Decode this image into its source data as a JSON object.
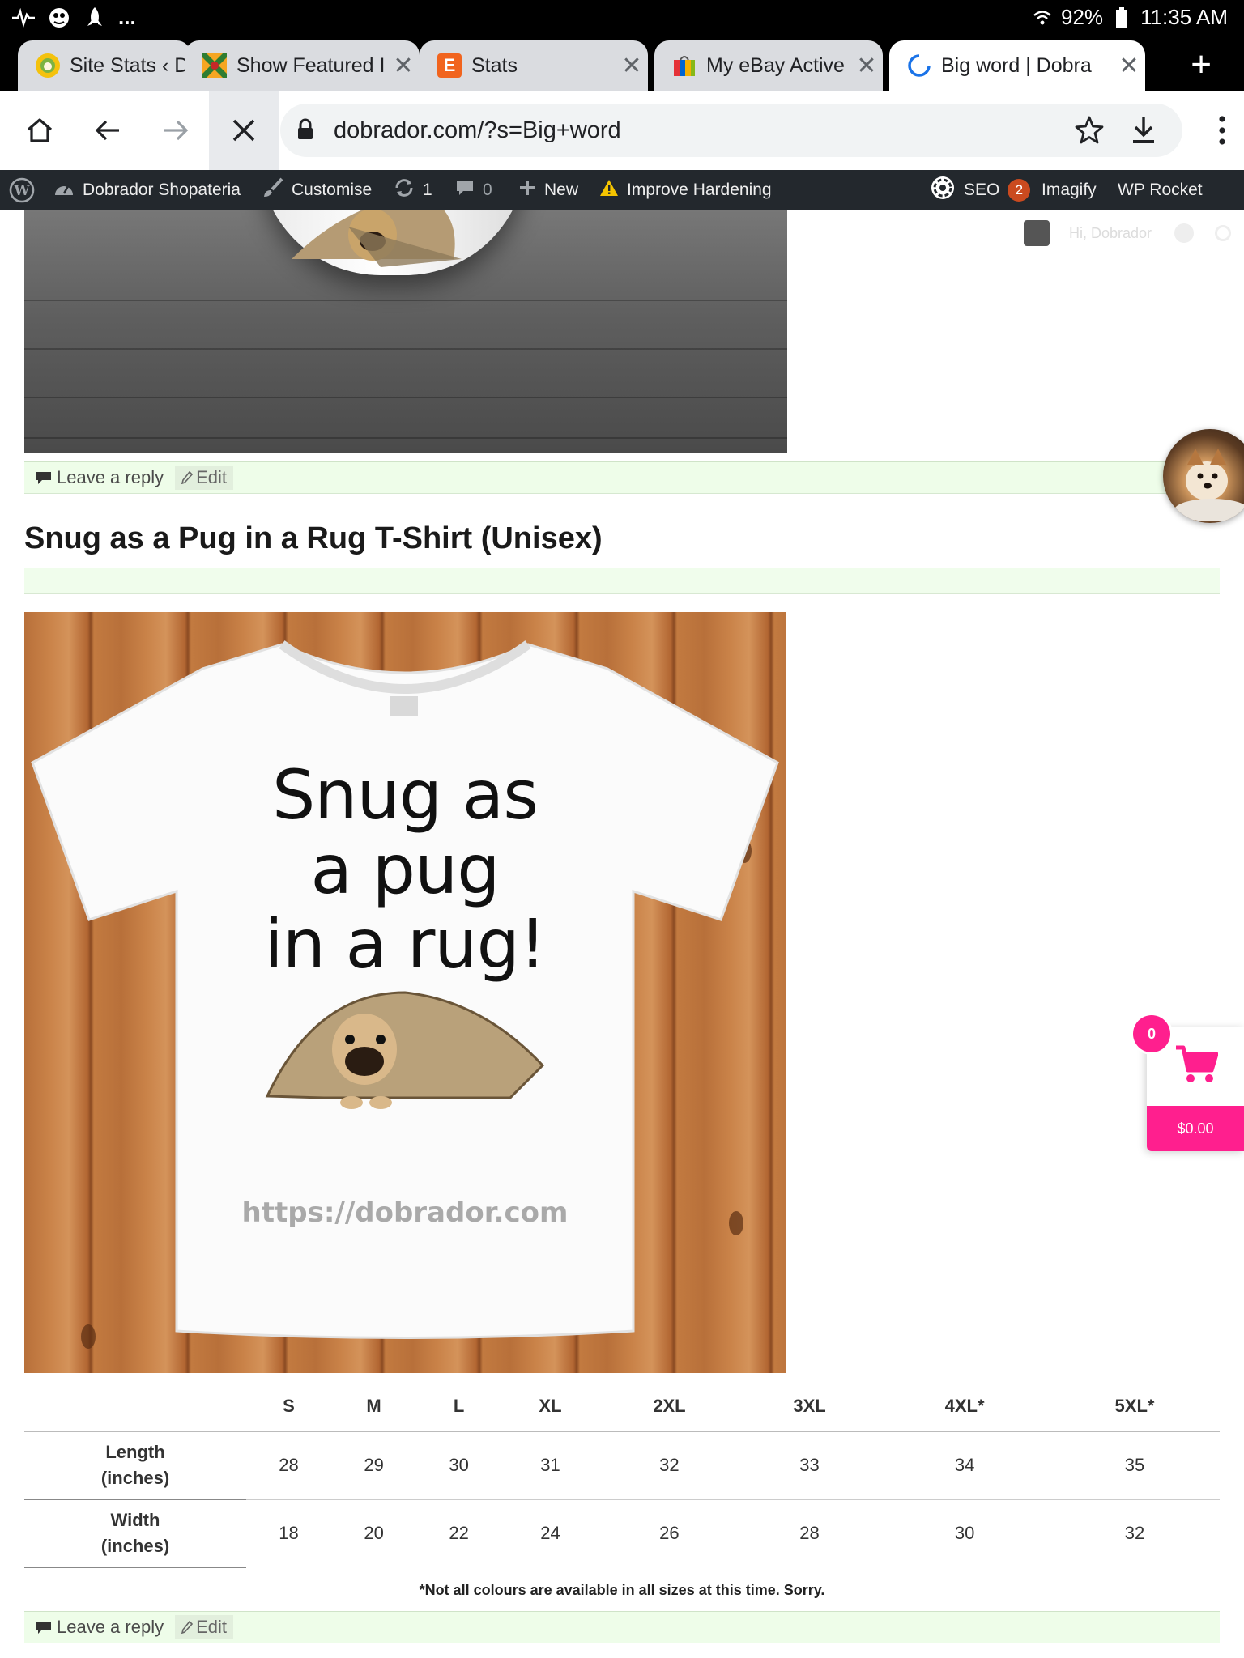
{
  "status_bar": {
    "battery": "92%",
    "time": "11:35 AM",
    "more": "..."
  },
  "tabs": [
    {
      "title": "Site Stats ‹ D"
    },
    {
      "title": "Show Featured I"
    },
    {
      "title": "Stats"
    },
    {
      "title": "My eBay Active"
    },
    {
      "title": "Big word | Dobra"
    }
  ],
  "omnibox": {
    "url": "dobrador.com/?s=Big+word"
  },
  "admin_bar": {
    "site_name": "Dobrador Shopateria",
    "customise": "Customise",
    "updates_count": "1",
    "comments_count": "0",
    "new": "New",
    "improve": "Improve Hardening",
    "seo": "SEO",
    "seo_count": "2",
    "imagify": "Imagify",
    "wp_rocket": "WP Rocket"
  },
  "page_header": {
    "greeting": "Hi, Dobrador"
  },
  "post_meta": {
    "leave_reply": "Leave a reply",
    "edit": "Edit"
  },
  "post": {
    "title": "Snug as a Pug in a Rug T-Shirt (Unisex)",
    "shirt_lines": [
      "Snug as",
      "a pug",
      "in a rug!"
    ],
    "shirt_url": "https://dobrador.com"
  },
  "size_table": {
    "headers": [
      "",
      "S",
      "M",
      "L",
      "XL",
      "2XL",
      "3XL",
      "4XL*",
      "5XL*"
    ],
    "rows": [
      {
        "label_line1": "Length",
        "label_line2": "(inches)",
        "values": [
          "28",
          "29",
          "30",
          "31",
          "32",
          "33",
          "34",
          "35"
        ]
      },
      {
        "label_line1": "Width",
        "label_line2": "(inches)",
        "values": [
          "18",
          "20",
          "22",
          "24",
          "26",
          "28",
          "30",
          "32"
        ]
      }
    ],
    "note": "*Not all colours are available in all sizes at this time. Sorry."
  },
  "cart": {
    "count": "0",
    "total": "$0.00"
  },
  "colors": {
    "accent_pink": "#ff1f8e",
    "admin_bar": "#23282d",
    "seo_badge": "#ca4a1f",
    "meta_green": "#eefde9"
  }
}
